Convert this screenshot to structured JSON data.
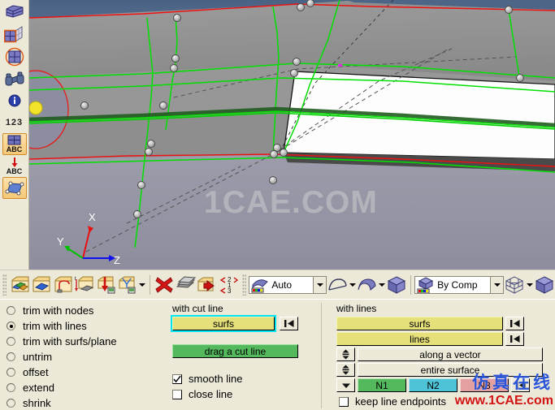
{
  "app": {
    "watermark_main": "1CAE.COM",
    "watermark_cn": "仿真在线",
    "watermark_url": "www.1CAE.com"
  },
  "left_toolbar": {
    "items": [
      {
        "icon": "mesh-cube-icon",
        "label": "",
        "selected": false
      },
      {
        "icon": "mesh-grid-icon",
        "label": "",
        "selected": false
      },
      {
        "icon": "mesh-circle-icon",
        "label": "",
        "selected": false
      },
      {
        "icon": "binoculars-icon",
        "label": "",
        "selected": false
      },
      {
        "icon": "info-icon",
        "label": "",
        "selected": false
      },
      {
        "icon": "numbers-123-icon",
        "label": "123",
        "selected": false
      },
      {
        "icon": "mesh-abc-icon",
        "label": "ABC",
        "selected": true
      },
      {
        "icon": "arrow-abc-icon",
        "label": "ABC",
        "selected": false
      },
      {
        "icon": "surface-patch-icon",
        "label": "",
        "selected": true
      }
    ]
  },
  "viewport": {
    "axes": {
      "x": "X",
      "y": "Y",
      "z": "Z"
    },
    "axis_colors": {
      "x": "#e81010",
      "y": "#00c000",
      "z": "#1010f0"
    },
    "background_top": "#4c6484",
    "background_main": "#8f8f8f",
    "edge_color_red": "#ee1111",
    "edge_color_green": "#00e000"
  },
  "htoolbar": {
    "groups": [
      {
        "icons": [
          "create-surfaces-icon",
          "create-solid-icon",
          "spline-surface-icon",
          "drag-surface-icon",
          "project-surface-icon",
          "ruled-surface-icon"
        ]
      },
      {
        "icons": [
          "delete-surface-icon",
          "midsurface-icon",
          "defeature-icon",
          "renumber-icon"
        ]
      }
    ],
    "normals_combo": {
      "value": "Auto",
      "icon": "surface-normals-icon"
    },
    "extra_icons": [
      "surface-edge-icon",
      "surface-shade-icon",
      "cube-shade-icon"
    ],
    "color_combo": {
      "value": "By Comp",
      "icon": "color-by-comp-icon"
    },
    "view_icons": [
      "wireframe-cube-icon",
      "solid-cube-icon"
    ]
  },
  "panel": {
    "mode_options": [
      {
        "label": "trim with nodes",
        "selected": false
      },
      {
        "label": "trim with lines",
        "selected": true
      },
      {
        "label": "trim with surfs/plane",
        "selected": false
      },
      {
        "label": "untrim",
        "selected": false
      },
      {
        "label": "offset",
        "selected": false
      },
      {
        "label": "extend",
        "selected": false
      },
      {
        "label": "shrink",
        "selected": false
      }
    ],
    "cut_line": {
      "title": "with cut line",
      "entity_button": "surfs",
      "entity_selected": true,
      "rewind_icon": "rewind-icon",
      "action_button": "drag a cut line",
      "checkboxes": [
        {
          "label": "smooth line",
          "checked": true
        },
        {
          "label": "close line",
          "checked": false
        }
      ]
    },
    "with_lines": {
      "title": "with lines",
      "rows": [
        {
          "type": "entity",
          "label": "surfs",
          "rewind_icon": "rewind-icon"
        },
        {
          "type": "entity",
          "label": "lines",
          "rewind_icon": "rewind-icon"
        },
        {
          "type": "spinner",
          "label": "along a vector",
          "spin_icon": "updown-icon"
        },
        {
          "type": "spinner",
          "label": "entire surface",
          "spin_icon": "updown-icon"
        }
      ],
      "node_buttons": [
        {
          "label": "N1",
          "color": "#54b95c"
        },
        {
          "label": "N2",
          "color": "#4ec3d8"
        },
        {
          "label": "N3",
          "color": "#e4a0a0"
        }
      ],
      "dropdown_icon": "chevron-down-icon",
      "last_rewind_icon": "rewind-icon",
      "keep_endpoints": {
        "label": "keep line endpoints",
        "checked": false
      }
    }
  }
}
